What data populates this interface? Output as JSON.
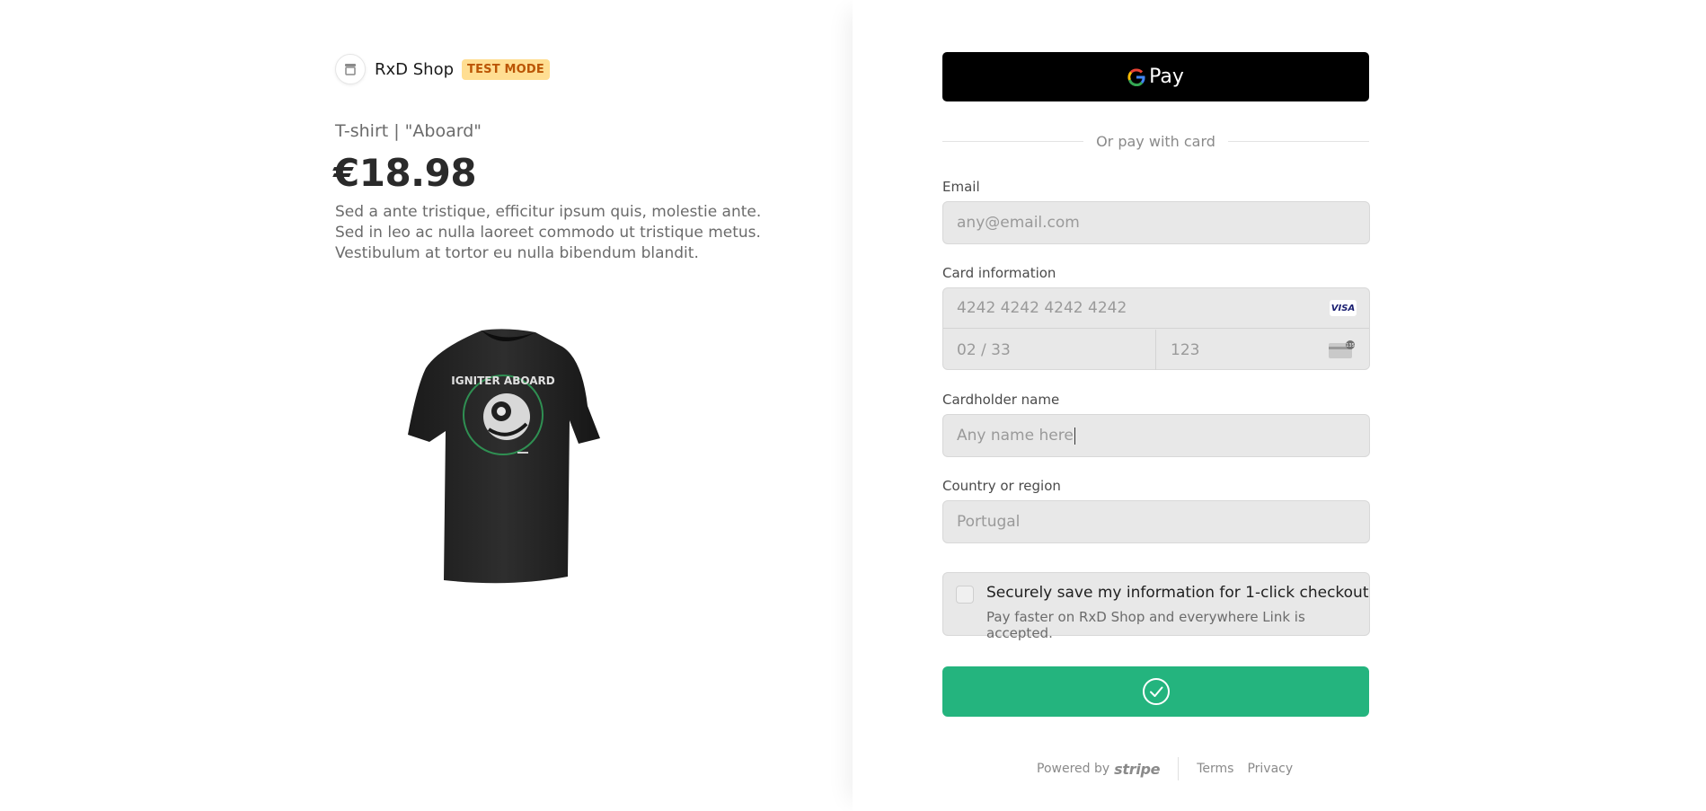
{
  "shop": {
    "name": "RxD Shop",
    "badge": "TEST MODE"
  },
  "product": {
    "name": "T-shirt | \"Aboard\"",
    "price": "€18.98",
    "description": "Sed a ante tristique, efficitur ipsum quis, molestie ante. Sed in leo ac nulla laoreet commodo ut tristique metus. Vestibulum at tortor eu nulla bibendum blandit.",
    "image_icon": "tshirt-image",
    "shirt_print_text": "IGNITER ABOARD"
  },
  "payment": {
    "gpay_label": "Pay",
    "divider_text": "Or pay with card",
    "email": {
      "label": "Email",
      "placeholder": "any@email.com"
    },
    "card": {
      "label": "Card information",
      "number_placeholder": "4242 4242 4242 4242",
      "brand_badge": "VISA",
      "expiry_placeholder": "02 / 33",
      "cvc_placeholder": "123",
      "cvc_icon_text": "135"
    },
    "cardholder": {
      "label": "Cardholder name",
      "placeholder": "Any name here"
    },
    "country": {
      "label": "Country or region",
      "value": "Portugal"
    },
    "save": {
      "checked": false,
      "title": "Securely save my information for 1-click checkout",
      "subtitle": "Pay faster on RxD Shop and everywhere Link is accepted."
    },
    "pay_button_icon": "checkmark-circle-icon"
  },
  "footer": {
    "powered_by": "Powered by",
    "brand": "stripe",
    "terms": "Terms",
    "privacy": "Privacy"
  },
  "colors": {
    "accent_green": "#24b47e",
    "badge_bg": "#ffde92",
    "badge_text": "#bb5504",
    "gpay_bg": "#000000"
  }
}
